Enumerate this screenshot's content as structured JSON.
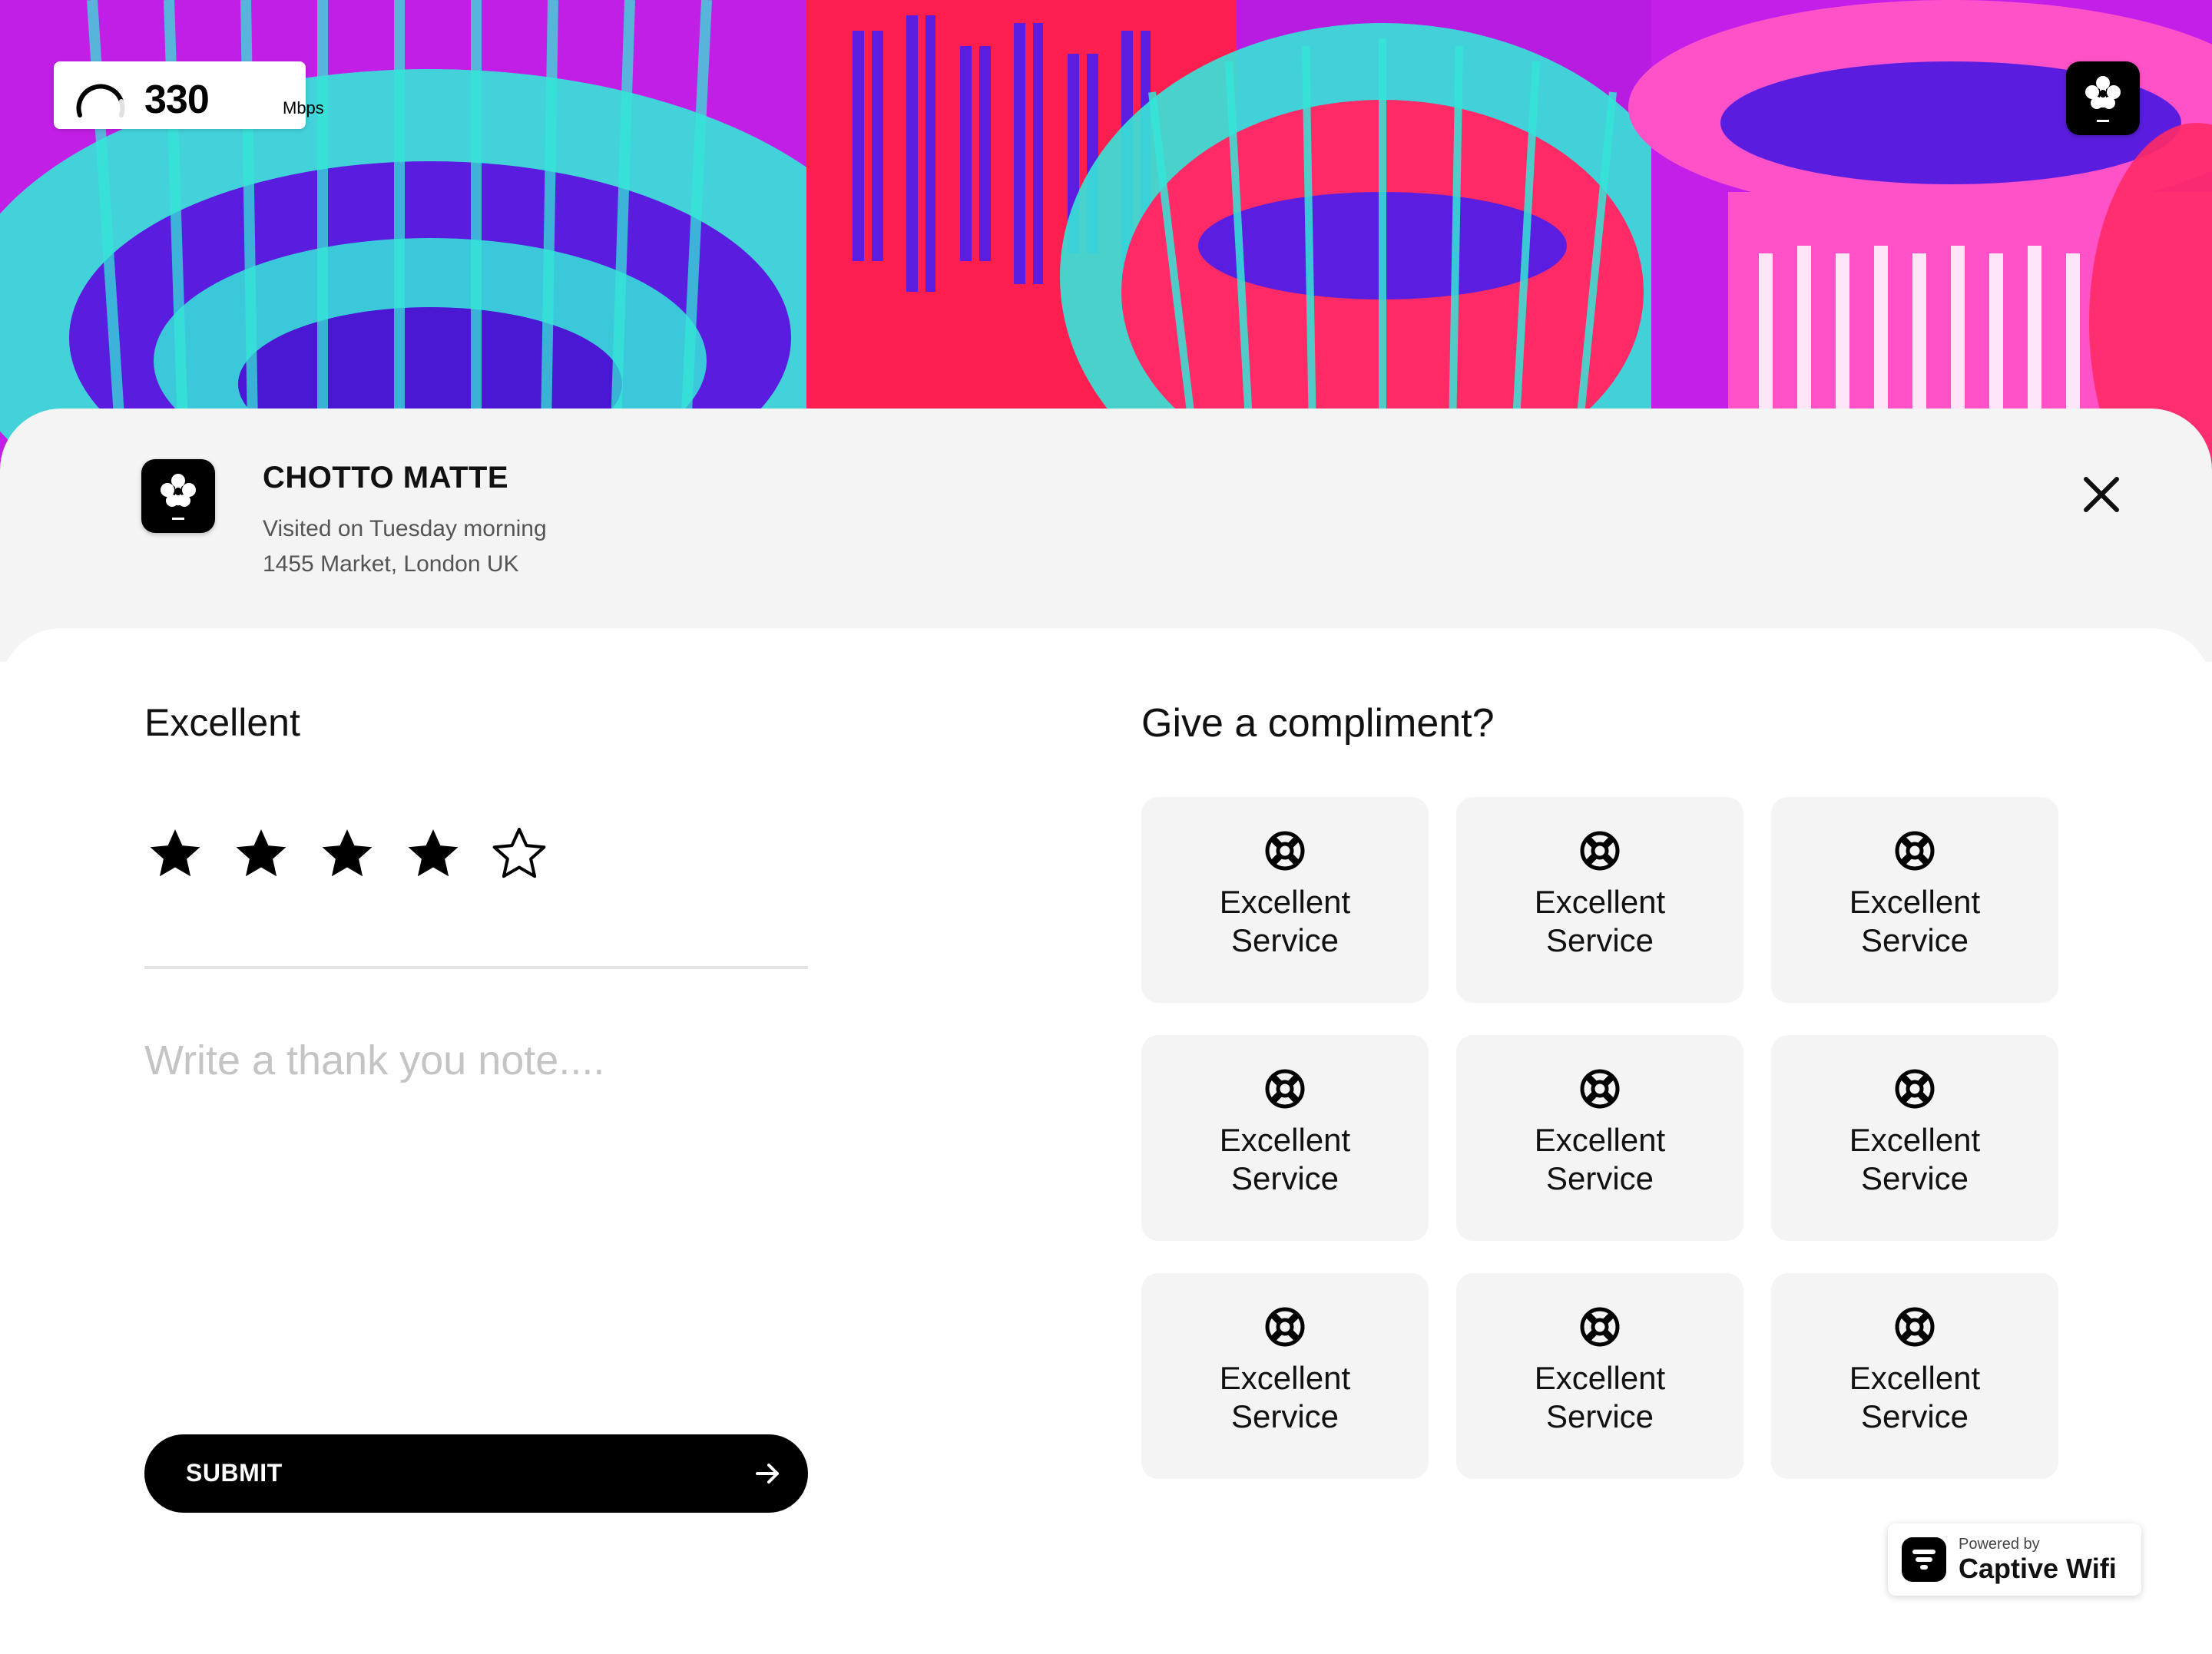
{
  "speed": {
    "value": "330",
    "unit": "Mbps",
    "gauge_icon": "speed-gauge-icon"
  },
  "venue": {
    "name": "CHOTTO MATTE",
    "visit": "Visited on Tuesday morning",
    "address": "1455 Market, London UK",
    "logo_icon": "chotto-matte-logo-icon",
    "close_icon": "close-icon"
  },
  "rating": {
    "label": "Excellent",
    "value": 4,
    "max": 5,
    "icons": [
      "star-filled-icon",
      "star-outline-icon"
    ]
  },
  "note": {
    "placeholder": "Write a thank you note...."
  },
  "submit": {
    "label": "SUBMIT",
    "icon": "arrow-right-icon"
  },
  "compliments": {
    "title": "Give a compliment?",
    "tile_icon": "life-ring-icon",
    "items": [
      {
        "label": "Excellent Service"
      },
      {
        "label": "Excellent Service"
      },
      {
        "label": "Excellent Service"
      },
      {
        "label": "Excellent Service"
      },
      {
        "label": "Excellent Service"
      },
      {
        "label": "Excellent Service"
      },
      {
        "label": "Excellent Service"
      },
      {
        "label": "Excellent Service"
      },
      {
        "label": "Excellent Service"
      }
    ]
  },
  "powered": {
    "prefix": "Powered by",
    "brand": "Captive Wifi",
    "logo_icon": "captive-wifi-logo-icon"
  },
  "colors": {
    "hero_magenta": "#c51ee6",
    "hero_cyan": "#33e3d8",
    "hero_red": "#ff1f4f",
    "hero_violet": "#5b1ee0",
    "hero_pink": "#ff4fc8",
    "panel_gray": "#f4f4f4",
    "tile_gray": "#f4f4f4",
    "button_black": "#000000",
    "placeholder_gray": "#c4c4c4"
  }
}
